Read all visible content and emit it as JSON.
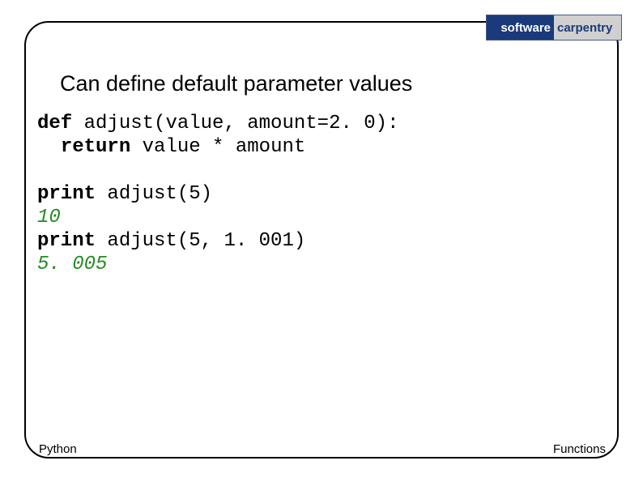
{
  "logo": {
    "left": "software",
    "right": "carpentry"
  },
  "title": "Can define default parameter values",
  "code": {
    "line1_kw": "def",
    "line1_rest": " adjust(value, amount=2. 0):",
    "line2_indent": "  ",
    "line2_kw": "return",
    "line2_rest": " value * amount",
    "line3_kw": "print",
    "line3_rest": " adjust(5)",
    "line4_out": "10",
    "line5_kw": "print",
    "line5_rest": " adjust(5, 1. 001)",
    "line6_out": "5. 005"
  },
  "footer": {
    "left": "Python",
    "right": "Functions"
  }
}
